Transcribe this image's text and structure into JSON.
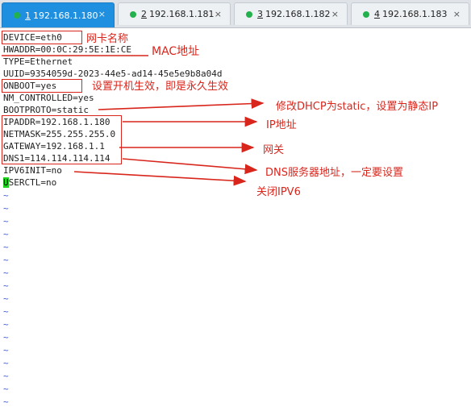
{
  "tabs": [
    {
      "num": "1",
      "label": "192.168.1.180",
      "close": "×",
      "active": true
    },
    {
      "num": "2",
      "label": "192.168.1.181",
      "close": "×",
      "active": false
    },
    {
      "num": "3",
      "label": "192.168.1.182",
      "close": "×",
      "active": false
    },
    {
      "num": "4",
      "label": "192.168.1.183",
      "close": "×",
      "active": false
    }
  ],
  "terminal": {
    "lines": [
      "DEVICE=eth0",
      "HWADDR=00:0C:29:5E:1E:CE",
      "TYPE=Ethernet",
      "UUID=9354059d-2023-44e5-ad14-45e5e9b8a04d",
      "ONBOOT=yes",
      "NM_CONTROLLED=yes",
      "BOOTPROTO=static",
      "IPADDR=192.168.1.180",
      "NETMASK=255.255.255.0",
      "GATEWAY=192.168.1.1",
      "DNS1=114.114.114.114",
      "IPV6INIT=no"
    ],
    "cursor_line": {
      "cursor_char": "U",
      "rest": "SERCTL=no"
    },
    "tilde": "~"
  },
  "annotations": {
    "nic_name": "网卡名称",
    "mac": "MAC地址",
    "onboot": "设置开机生效，即是永久生效",
    "bootproto": "修改DHCP为static，设置为静态IP",
    "ip": "IP地址",
    "gateway": "网关",
    "dns": "DNS服务器地址，一定要设置",
    "ipv6": "关闭IPV6"
  },
  "colors": {
    "annotation": "#d9261c",
    "active_tab": "#1f8fe0",
    "status_dot": "#22b14c",
    "cursor": "#1fd11f",
    "tilde": "#3f5ad8"
  }
}
